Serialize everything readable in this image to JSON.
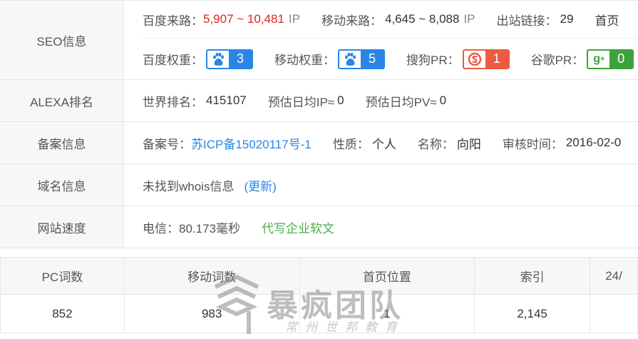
{
  "seo": {
    "label": "SEO信息",
    "baidu_traffic_label": "百度来路：",
    "baidu_traffic_value": "5,907 ~ 10,481",
    "baidu_traffic_unit": "IP",
    "mobile_traffic_label": "移动来路：",
    "mobile_traffic_value": "4,645 ~ 8,088",
    "mobile_traffic_unit": "IP",
    "outbound_label": "出站链接：",
    "outbound_value": "29",
    "home_label": "首页",
    "baidu_weight_label": "百度权重：",
    "baidu_weight_value": "3",
    "mobile_weight_label": "移动权重：",
    "mobile_weight_value": "5",
    "sogou_pr_label": "搜狗PR：",
    "sogou_pr_value": "1",
    "google_pr_label": "谷歌PR：",
    "google_pr_value": "0",
    "colors": {
      "blue": "#2b85e4",
      "red": "#ec5a43",
      "green": "#3ca33c",
      "traffic_red": "#d9261c"
    },
    "icons": [
      "baidu-paw-icon",
      "baidu-paw-icon",
      "sogou-icon",
      "google-plus-icon"
    ]
  },
  "alexa": {
    "label": "ALEXA排名",
    "world_rank_label": "世界排名：",
    "world_rank_value": "415107",
    "est_ip_label": "预估日均IP≈",
    "est_ip_value": "0",
    "est_pv_label": "预估日均PV≈",
    "est_pv_value": "0"
  },
  "icp": {
    "label": "备案信息",
    "number_label": "备案号：",
    "number_value": "苏ICP备15020117号-1",
    "nature_label": "性质：",
    "nature_value": "个人",
    "name_label": "名称：",
    "name_value": "向阳",
    "review_label": "审核时间：",
    "review_value": "2016-02-0"
  },
  "domain": {
    "label": "域名信息",
    "status": "未找到whois信息",
    "update_link": "(更新)"
  },
  "speed": {
    "label": "网站速度",
    "telecom": "电信：80.173毫秒",
    "ad_link": "代写企业软文"
  },
  "rank_table": {
    "headers": [
      "PC词数",
      "移动词数",
      "首页位置",
      "索引",
      "24/"
    ],
    "row": [
      "852",
      "983",
      "1",
      "2,145",
      ""
    ]
  },
  "watermark": {
    "title": "暴疯团队",
    "subtitle": "常州世邦教育"
  }
}
